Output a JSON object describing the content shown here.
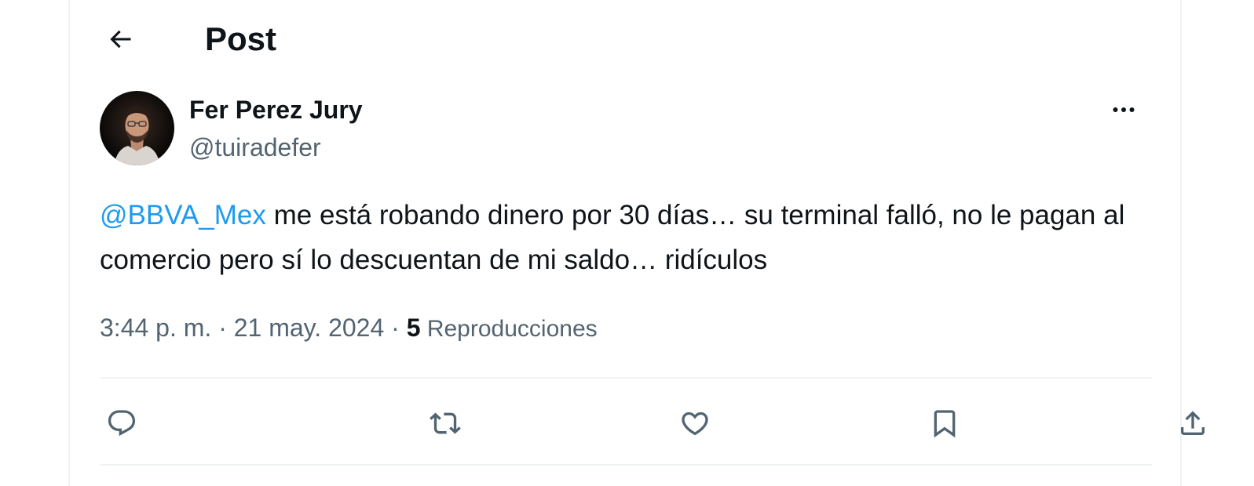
{
  "header": {
    "title": "Post",
    "back_icon": "arrow-left-icon"
  },
  "author": {
    "name": "Fer Perez Jury",
    "handle": "@tuiradefer",
    "avatar_icon": "user-avatar"
  },
  "tweet": {
    "mention": "@BBVA_Mex",
    "text": " me está robando dinero por 30 días… su terminal falló, no le pagan al comercio pero sí lo descuentan de mi saldo… ridículos"
  },
  "meta": {
    "time": "3:44 p. m.",
    "separator": " · ",
    "date": "21 may. 2024",
    "separator2": " · ",
    "views_count": "5",
    "views_label": " Reproducciones"
  },
  "actions": {
    "reply_icon": "reply-icon",
    "retweet_icon": "retweet-icon",
    "like_icon": "heart-icon",
    "bookmark_icon": "bookmark-icon",
    "share_icon": "share-icon"
  },
  "colors": {
    "text": "#0f1419",
    "secondary": "#536471",
    "link": "#1d9bf0",
    "border": "#eff3f4"
  }
}
